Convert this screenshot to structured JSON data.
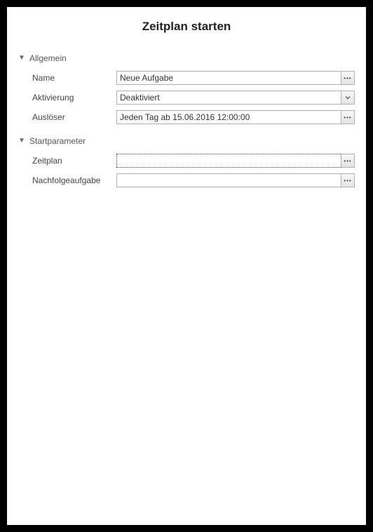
{
  "title": "Zeitplan starten",
  "sections": {
    "general": {
      "title": "Allgemein",
      "fields": {
        "name": {
          "label": "Name",
          "value": "Neue Aufgabe"
        },
        "activation": {
          "label": "Aktivierung",
          "value": "Deaktiviert"
        },
        "trigger": {
          "label": "Auslöser",
          "value": "Jeden Tag ab 15.06.2016 12:00:00"
        }
      }
    },
    "startparams": {
      "title": "Startparameter",
      "fields": {
        "schedule": {
          "label": "Zeitplan",
          "value": ""
        },
        "followup": {
          "label": "Nachfolgeaufgabe",
          "value": ""
        }
      }
    }
  }
}
